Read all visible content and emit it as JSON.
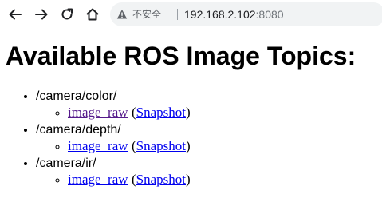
{
  "browser": {
    "security_label": "不安全",
    "url_host": "192.168.2.102",
    "url_port": ":8080",
    "icons": [
      "back-arrow-icon",
      "forward-arrow-icon",
      "reload-icon",
      "home-icon",
      "warning-triangle-icon"
    ]
  },
  "page": {
    "title": "Available ROS Image Topics:",
    "topics": [
      {
        "name": "/camera/color/",
        "stream_label": "image_raw",
        "open_paren": "(",
        "snapshot_label": "Snapshot",
        "close_paren": ")",
        "stream_visited": true
      },
      {
        "name": "/camera/depth/",
        "stream_label": "image_raw",
        "open_paren": "(",
        "snapshot_label": "Snapshot",
        "close_paren": ")",
        "stream_visited": false
      },
      {
        "name": "/camera/ir/",
        "stream_label": "image_raw",
        "open_paren": "(",
        "snapshot_label": "Snapshot",
        "close_paren": ")",
        "stream_visited": false
      }
    ]
  },
  "colors": {
    "visited_link": "#551a8b",
    "unvisited_link": "#0000ee",
    "omnibox_bg": "#f1f3f4"
  }
}
